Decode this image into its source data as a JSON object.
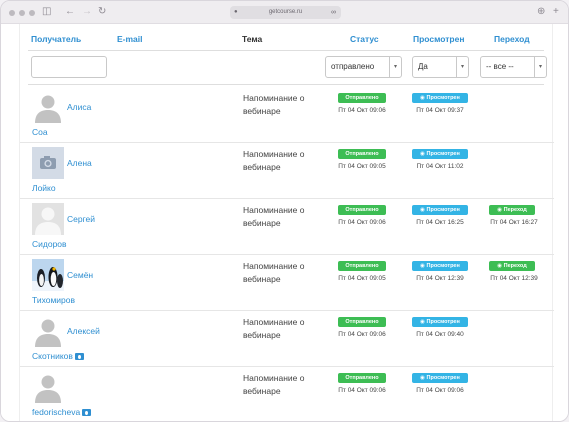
{
  "browser": {
    "url": "getcourse.ru",
    "icons": [
      "sidebar-icon",
      "back-icon",
      "forward-icon",
      "reload-icon",
      "shield-icon",
      "link-icon",
      "download-icon",
      "new-tab-icon"
    ]
  },
  "table": {
    "headers": {
      "recipient": "Получатель",
      "email": "E-mail",
      "subject": "Тема",
      "status": "Статус",
      "viewed": "Просмотрен",
      "clicked": "Переход"
    },
    "filters": {
      "recipient_value": "",
      "status_value": "отправлено",
      "viewed_value": "Да",
      "clicked_value": "-- все --"
    },
    "rows": [
      {
        "first_name": "Алиса",
        "last_name": "Соа",
        "avatar": "placeholder-person",
        "subject": "Напоминание о вебинаре",
        "status_label": "Отправлено",
        "status_time": "Пт 04 Окт 09:06",
        "viewed_label": "Просмотрен",
        "viewed_time": "Пт 04 Окт 09:37",
        "clicked_label": "",
        "clicked_time": "",
        "id_badge": false
      },
      {
        "first_name": "Алена",
        "last_name": "Лойко",
        "avatar": "camera-placeholder",
        "subject": "Напоминание о вебинаре",
        "status_label": "Отправлено",
        "status_time": "Пт 04 Окт 09:05",
        "viewed_label": "Просмотрен",
        "viewed_time": "Пт 04 Окт 11:02",
        "clicked_label": "",
        "clicked_time": "",
        "id_badge": false
      },
      {
        "first_name": "Сергей",
        "last_name": "Сидоров",
        "avatar": "placeholder-person-light",
        "subject": "Напоминание о вебинаре",
        "status_label": "Отправлено",
        "status_time": "Пт 04 Окт 09:06",
        "viewed_label": "Просмотрен",
        "viewed_time": "Пт 04 Окт 16:25",
        "clicked_label": "Переход",
        "clicked_time": "Пт 04 Окт 16:27",
        "id_badge": false
      },
      {
        "first_name": "Семён",
        "last_name": "Тихомиров",
        "avatar": "penguins-photo",
        "subject": "Напоминание о вебинаре",
        "status_label": "Отправлено",
        "status_time": "Пт 04 Окт 09:05",
        "viewed_label": "Просмотрен",
        "viewed_time": "Пт 04 Окт 12:39",
        "clicked_label": "Переход",
        "clicked_time": "Пт 04 Окт 12:39",
        "id_badge": false
      },
      {
        "first_name": "Алексей",
        "last_name": "Скотников",
        "avatar": "placeholder-person",
        "subject": "Напоминание о вебинаре",
        "status_label": "Отправлено",
        "status_time": "Пт 04 Окт 09:06",
        "viewed_label": "Просмотрен",
        "viewed_time": "Пт 04 Окт 09:40",
        "clicked_label": "",
        "clicked_time": "",
        "id_badge": true
      },
      {
        "first_name": "",
        "last_name": "fedorischeva",
        "avatar": "placeholder-person",
        "subject": "Напоминание о вебинаре",
        "status_label": "Отправлено",
        "status_time": "Пт 04 Окт 09:06",
        "viewed_label": "Просмотрен",
        "viewed_time": "Пт 04 Окт 09:06",
        "clicked_label": "",
        "clicked_time": "",
        "id_badge": true
      }
    ]
  },
  "colors": {
    "link": "#2f8fd1",
    "status_green": "#3dbd54",
    "viewed_blue": "#33b4e5"
  }
}
